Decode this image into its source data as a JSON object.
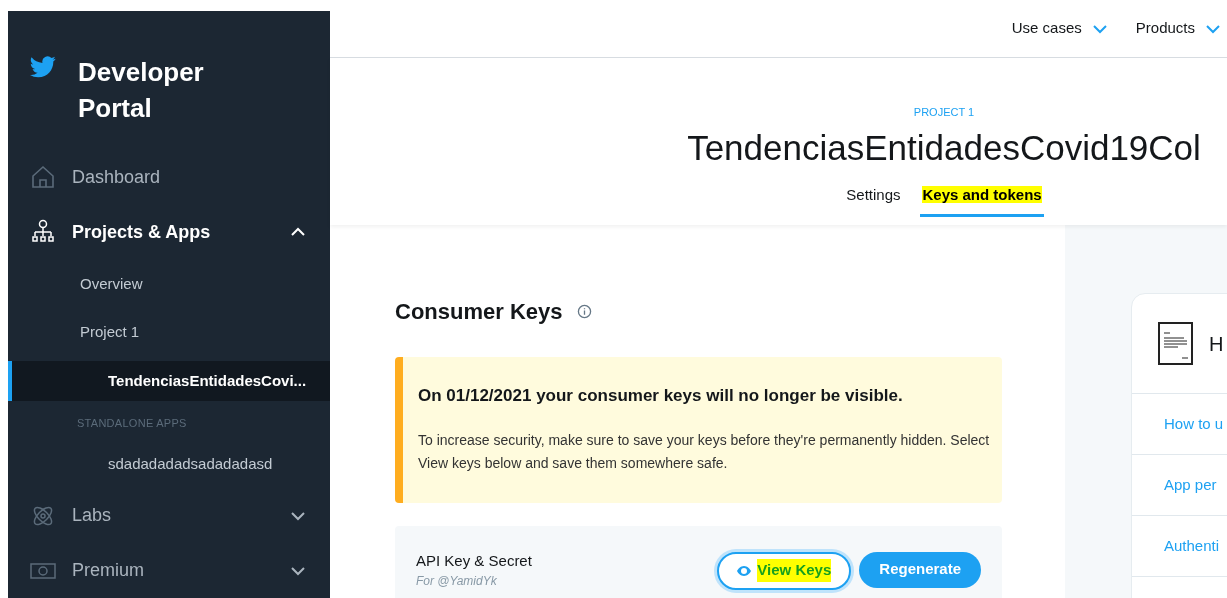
{
  "sidebar": {
    "brand": "Developer Portal",
    "items": [
      {
        "kind": "nav",
        "label": "Dashboard"
      },
      {
        "kind": "nav",
        "label": "Projects & Apps",
        "expanded": true
      },
      {
        "kind": "sub",
        "label": "Overview",
        "selected": false
      },
      {
        "kind": "sub",
        "label": "Project 1",
        "selected": false
      },
      {
        "kind": "app",
        "label": "TendenciasEntidadesCovi...",
        "selected": true
      },
      {
        "kind": "heading",
        "label": "STANDALONE APPS"
      },
      {
        "kind": "app",
        "label": "sdadadadadsadadadasd",
        "selected": false
      },
      {
        "kind": "nav",
        "label": "Labs",
        "expanded": false
      },
      {
        "kind": "nav",
        "label": "Premium",
        "expanded": false
      }
    ]
  },
  "top_nav": [
    {
      "label": "Use cases"
    },
    {
      "label": "Products"
    }
  ],
  "header": {
    "eyebrow": "PROJECT 1",
    "title": "TendenciasEntidadesCovid19Col",
    "tabs": [
      {
        "label": "Settings",
        "selected": false,
        "highlighted": false
      },
      {
        "label": "Keys and tokens",
        "selected": true,
        "highlighted": true
      }
    ]
  },
  "section": {
    "title": "Consumer Keys",
    "notice": {
      "title": "On 01/12/2021 your consumer keys will no longer be visible.",
      "body": "To increase security, make sure to save your keys before they're permanently hidden. Select View keys below and save them somewhere safe."
    },
    "key_row": {
      "label": "API Key & Secret",
      "owner": "For @YamidYk",
      "buttons": [
        {
          "kind": "outline",
          "label": "View Keys",
          "highlighted": true
        },
        {
          "kind": "solid",
          "label": "Regenerate",
          "highlighted": false
        }
      ]
    }
  },
  "help_card": {
    "title": "H",
    "links": [
      {
        "label": "How to u"
      },
      {
        "label": "App per"
      },
      {
        "label": "Authenti"
      }
    ]
  }
}
